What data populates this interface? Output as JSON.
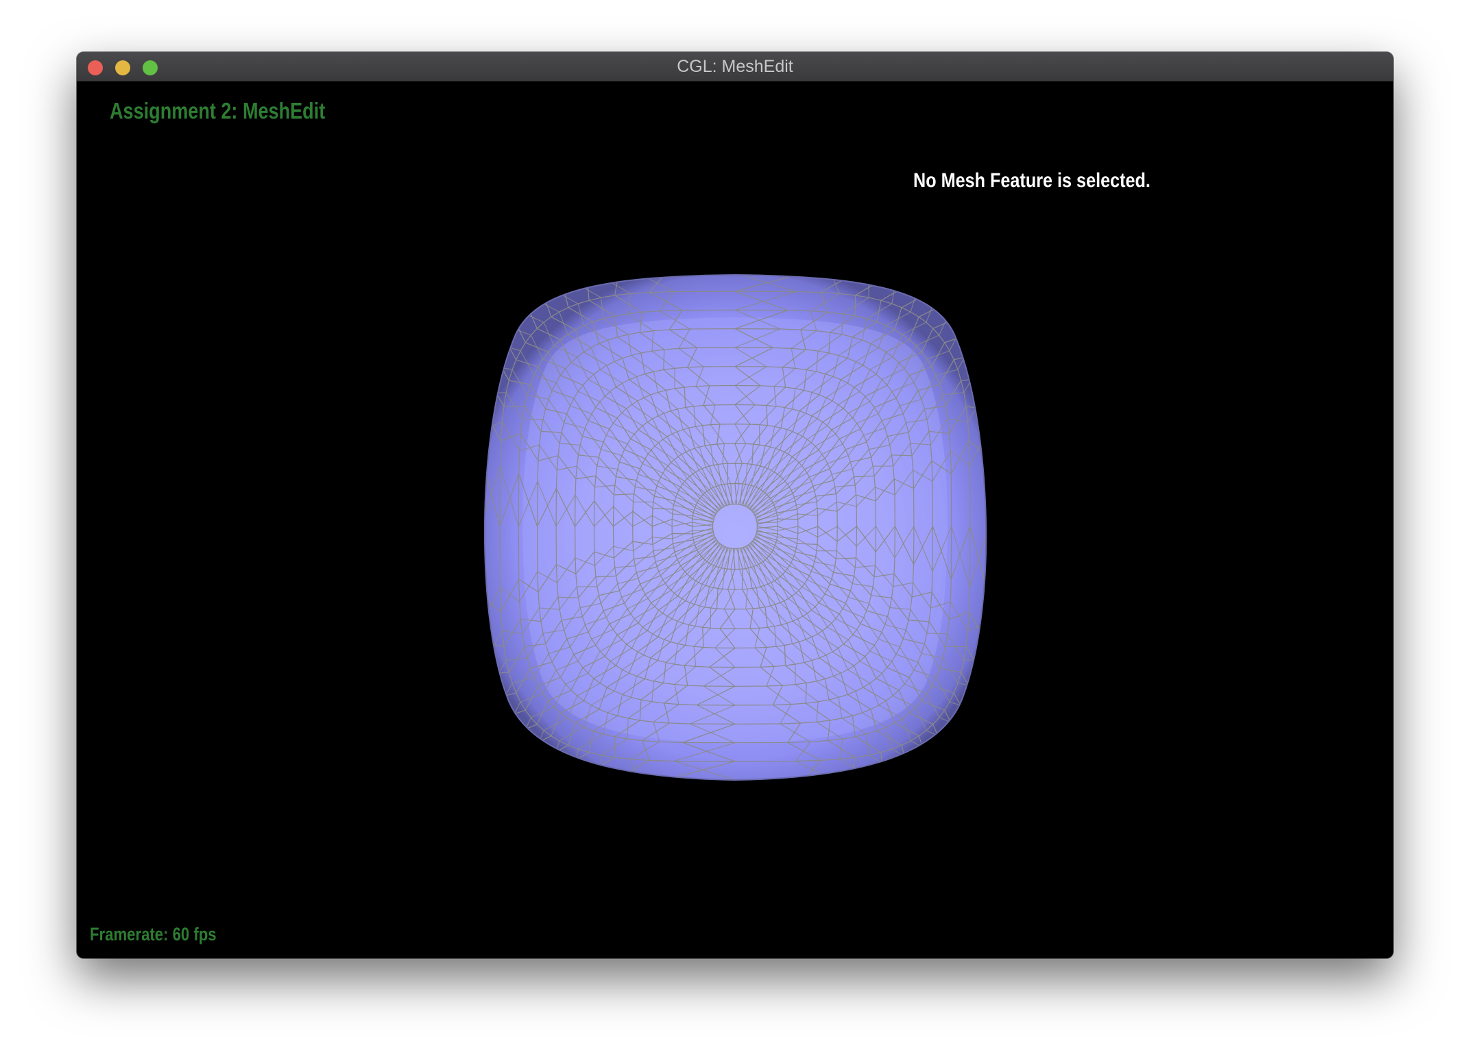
{
  "window": {
    "title": "CGL: MeshEdit",
    "traffic_lights": {
      "close_color": "#ec5f57",
      "minimize_color": "#e3b742",
      "maximize_color": "#62c045"
    }
  },
  "viewport": {
    "background_color": "#000000",
    "app_title": "Assignment 2: MeshEdit",
    "app_title_color": "#2e7d32",
    "selection_status": "No Mesh Feature is selected.",
    "selection_status_color": "#ffffff",
    "framerate_label": "Framerate: 60 fps",
    "framerate_color": "#2e7d32"
  },
  "mesh": {
    "shape": "subdivided-cube",
    "face_color": "#9898f2",
    "edge_color": "#8a8a8a"
  }
}
